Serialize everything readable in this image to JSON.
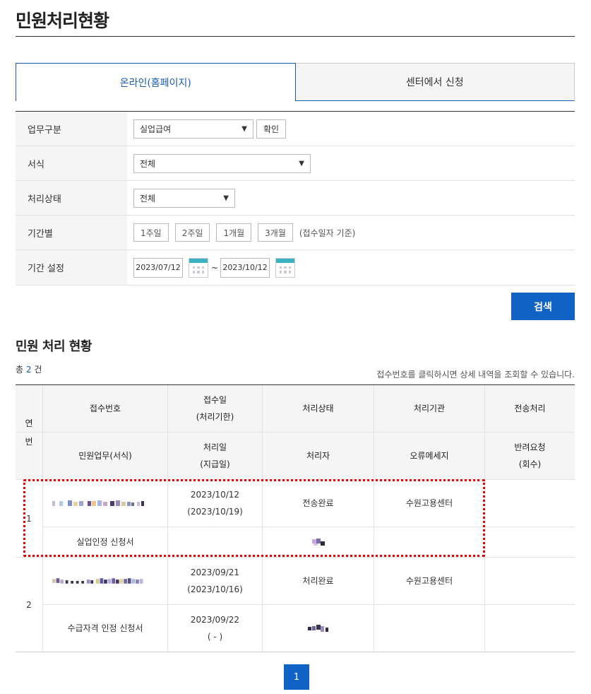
{
  "page": {
    "title": "민원처리현황"
  },
  "tabs": [
    {
      "label": "온라인(홈페이지)",
      "active": true
    },
    {
      "label": "센터에서 신청",
      "active": false
    }
  ],
  "form": {
    "business": {
      "label": "업무구분",
      "value": "실업급여",
      "confirm": "확인"
    },
    "form_type": {
      "label": "서식",
      "value": "전체"
    },
    "status": {
      "label": "처리상태",
      "value": "전체"
    },
    "period": {
      "label": "기간별",
      "buttons": [
        "1주일",
        "2주일",
        "1개월",
        "3개월"
      ],
      "note": "(접수일자 기준)"
    },
    "date_range": {
      "label": "기간 설정",
      "start": "2023/07/12",
      "end": "2023/10/12",
      "separator": "~"
    }
  },
  "search_label": "검색",
  "results": {
    "title": "민원 처리 현황",
    "total_prefix": "총 ",
    "total_count": "2",
    "total_suffix": " 건",
    "hint": "접수번호를 클릭하시면 상세 내역을 조회할 수 있습니다."
  },
  "table": {
    "headers": {
      "seq": "연\n번",
      "receipt_no": "접수번호",
      "receipt_date": "접수일\n(처리기한)",
      "status": "처리상태",
      "agency": "처리기관",
      "transfer": "전송처리",
      "task": "민원업무(서식)",
      "process_date": "처리일\n(지급일)",
      "handler": "처리자",
      "error": "오류메세지",
      "return_req": "반려요청\n(회수)"
    },
    "rows": [
      {
        "seq": "1",
        "receipt_date": "2023/10/12",
        "deadline": "(2023/10/19)",
        "status": "전송완료",
        "agency": "수원고용센터",
        "task": "실업인정 신청서",
        "process_date": "",
        "payment_date": ""
      },
      {
        "seq": "2",
        "receipt_date": "2023/09/21",
        "deadline": "(2023/10/16)",
        "status": "처리완료",
        "agency": "수원고용센터",
        "task": "수급자격 인정 신청서",
        "process_date": "2023/09/22",
        "payment_date": "( - )"
      }
    ]
  },
  "pagination": {
    "current": "1"
  },
  "colors": {
    "accent": "#1062c4",
    "tab_active": "#1a5cae",
    "highlight": "#e00000"
  }
}
